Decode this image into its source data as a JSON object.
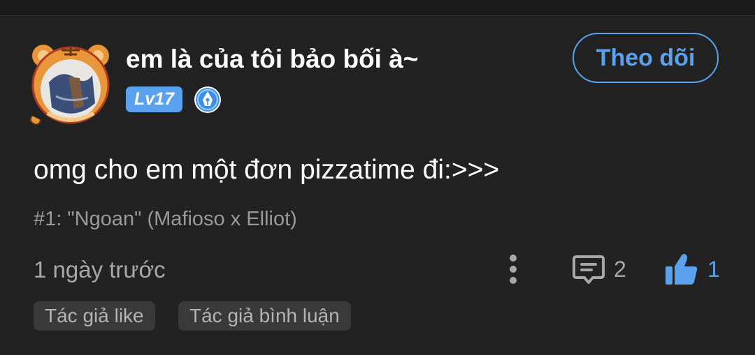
{
  "comment": {
    "author": {
      "name": "em là của tôi bảo bối à~",
      "level": "Lv17",
      "badge_icon": "pen-nib-icon",
      "avatar_icon": "tiger-avatar-icon"
    },
    "follow_label": "Theo dõi",
    "text": "omg cho em một đơn pizzatime đi:>>>",
    "chapter_ref": "#1: \"Ngoan\" (Mafioso x Elliot)",
    "timestamp": "1 ngày trước",
    "reply_count": "2",
    "like_count": "1",
    "tags": [
      "Tác giả like",
      "Tác giả bình luận"
    ]
  },
  "colors": {
    "background": "#222222",
    "accent": "#5aa2ee",
    "muted_text": "#a8a8a8",
    "tag_background": "#3a3a3a"
  }
}
